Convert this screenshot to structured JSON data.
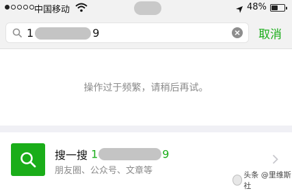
{
  "status_bar": {
    "carrier": "中国移动",
    "battery_percent": "48%",
    "battery_level": 0.48,
    "signal_dots_filled": 1,
    "signal_dots_total": 5,
    "icons": [
      "wifi-icon",
      "location-arrow-icon",
      "battery-icon"
    ]
  },
  "search": {
    "query_prefix": "1",
    "query_suffix": "9",
    "cancel_label": "取消",
    "icons": [
      "search-icon",
      "clear-icon"
    ]
  },
  "message": "操作过于频繁，请稍后再试。",
  "result": {
    "title_label": "搜一搜",
    "title_prefix": "1",
    "title_suffix": "9",
    "subtitle": "朋友圈、公众号、文章等",
    "icons": [
      "search-icon",
      "chevron-right-icon"
    ]
  },
  "watermark": {
    "text": "头条 @里维斯社"
  },
  "colors": {
    "accent_green": "#1aad19",
    "hint_gray": "#8a8a8a",
    "bar_background": "#f2f2f2"
  }
}
